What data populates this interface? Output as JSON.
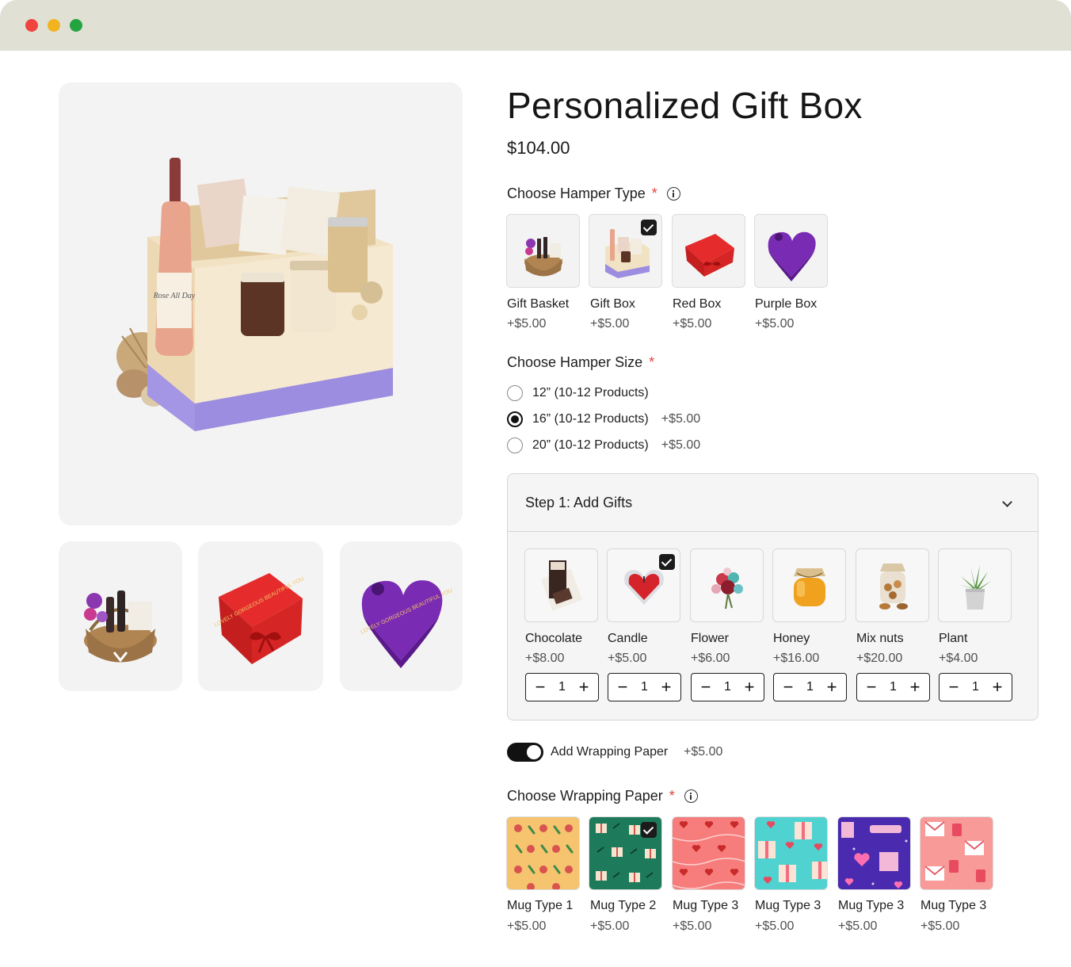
{
  "window": {
    "dots": [
      "#f0443f",
      "#f2b320",
      "#23a441"
    ]
  },
  "gallery": {
    "hero_label": "Rose All Day",
    "thumbs": [
      {
        "name": "gift-basket"
      },
      {
        "name": "red-box",
        "text": "LOVELY GORGEOUS BEAUTIFUL YOU"
      },
      {
        "name": "purple-heart-box",
        "text": "LOVELY GORGEOUS BEAUTIFUL YOU"
      }
    ]
  },
  "product": {
    "title": "Personalized Gift Box",
    "price": "$104.00"
  },
  "hamper_type": {
    "label": "Choose Hamper Type",
    "required": "*",
    "options": [
      {
        "name": "Gift Basket",
        "price": "+$5.00"
      },
      {
        "name": "Gift Box",
        "price": "+$5.00",
        "selected": true
      },
      {
        "name": "Red Box",
        "price": "+$5.00"
      },
      {
        "name": "Purple Box",
        "price": "+$5.00"
      }
    ]
  },
  "hamper_size": {
    "label": "Choose Hamper Size",
    "required": "*",
    "options": [
      {
        "label": "12” (10-12 Products)",
        "price": ""
      },
      {
        "label": "16” (10-12 Products)",
        "price": "+$5.00",
        "selected": true
      },
      {
        "label": "20” (10-12 Products)",
        "price": "+$5.00"
      }
    ]
  },
  "gifts": {
    "title": "Step 1: Add Gifts",
    "items": [
      {
        "name": "Chocolate",
        "price": "+$8.00",
        "qty": "1",
        "minus": "−",
        "plus": "+"
      },
      {
        "name": "Candle",
        "price": "+$5.00",
        "qty": "1",
        "minus": "−",
        "plus": "+",
        "selected": true
      },
      {
        "name": "Flower",
        "price": "+$6.00",
        "qty": "1",
        "minus": "−",
        "plus": "+"
      },
      {
        "name": "Honey",
        "price": "+$16.00",
        "qty": "1",
        "minus": "−",
        "plus": "+"
      },
      {
        "name": "Mix nuts",
        "price": "+$20.00",
        "qty": "1",
        "minus": "−",
        "plus": "+"
      },
      {
        "name": "Plant",
        "price": "+$4.00",
        "qty": "1",
        "minus": "−",
        "plus": "+"
      }
    ]
  },
  "wrapping_toggle": {
    "label": "Add Wrapping Paper",
    "price": "+$5.00",
    "on": true
  },
  "wrapping_paper": {
    "label": "Choose Wrapping Paper",
    "required": "*",
    "options": [
      {
        "name": "Mug Type 1",
        "price": "+$5.00",
        "bg": "#f6c36f"
      },
      {
        "name": "Mug Type 2",
        "price": "+$5.00",
        "bg": "#1d7b5c",
        "selected": true
      },
      {
        "name": "Mug Type 3",
        "price": "+$5.00",
        "bg": "#f77d7c"
      },
      {
        "name": "Mug Type 3",
        "price": "+$5.00",
        "bg": "#4fd2d0"
      },
      {
        "name": "Mug Type 3",
        "price": "+$5.00",
        "bg": "#4a2bb0"
      },
      {
        "name": "Mug Type 3",
        "price": "+$5.00",
        "bg": "#f79a98"
      }
    ]
  }
}
